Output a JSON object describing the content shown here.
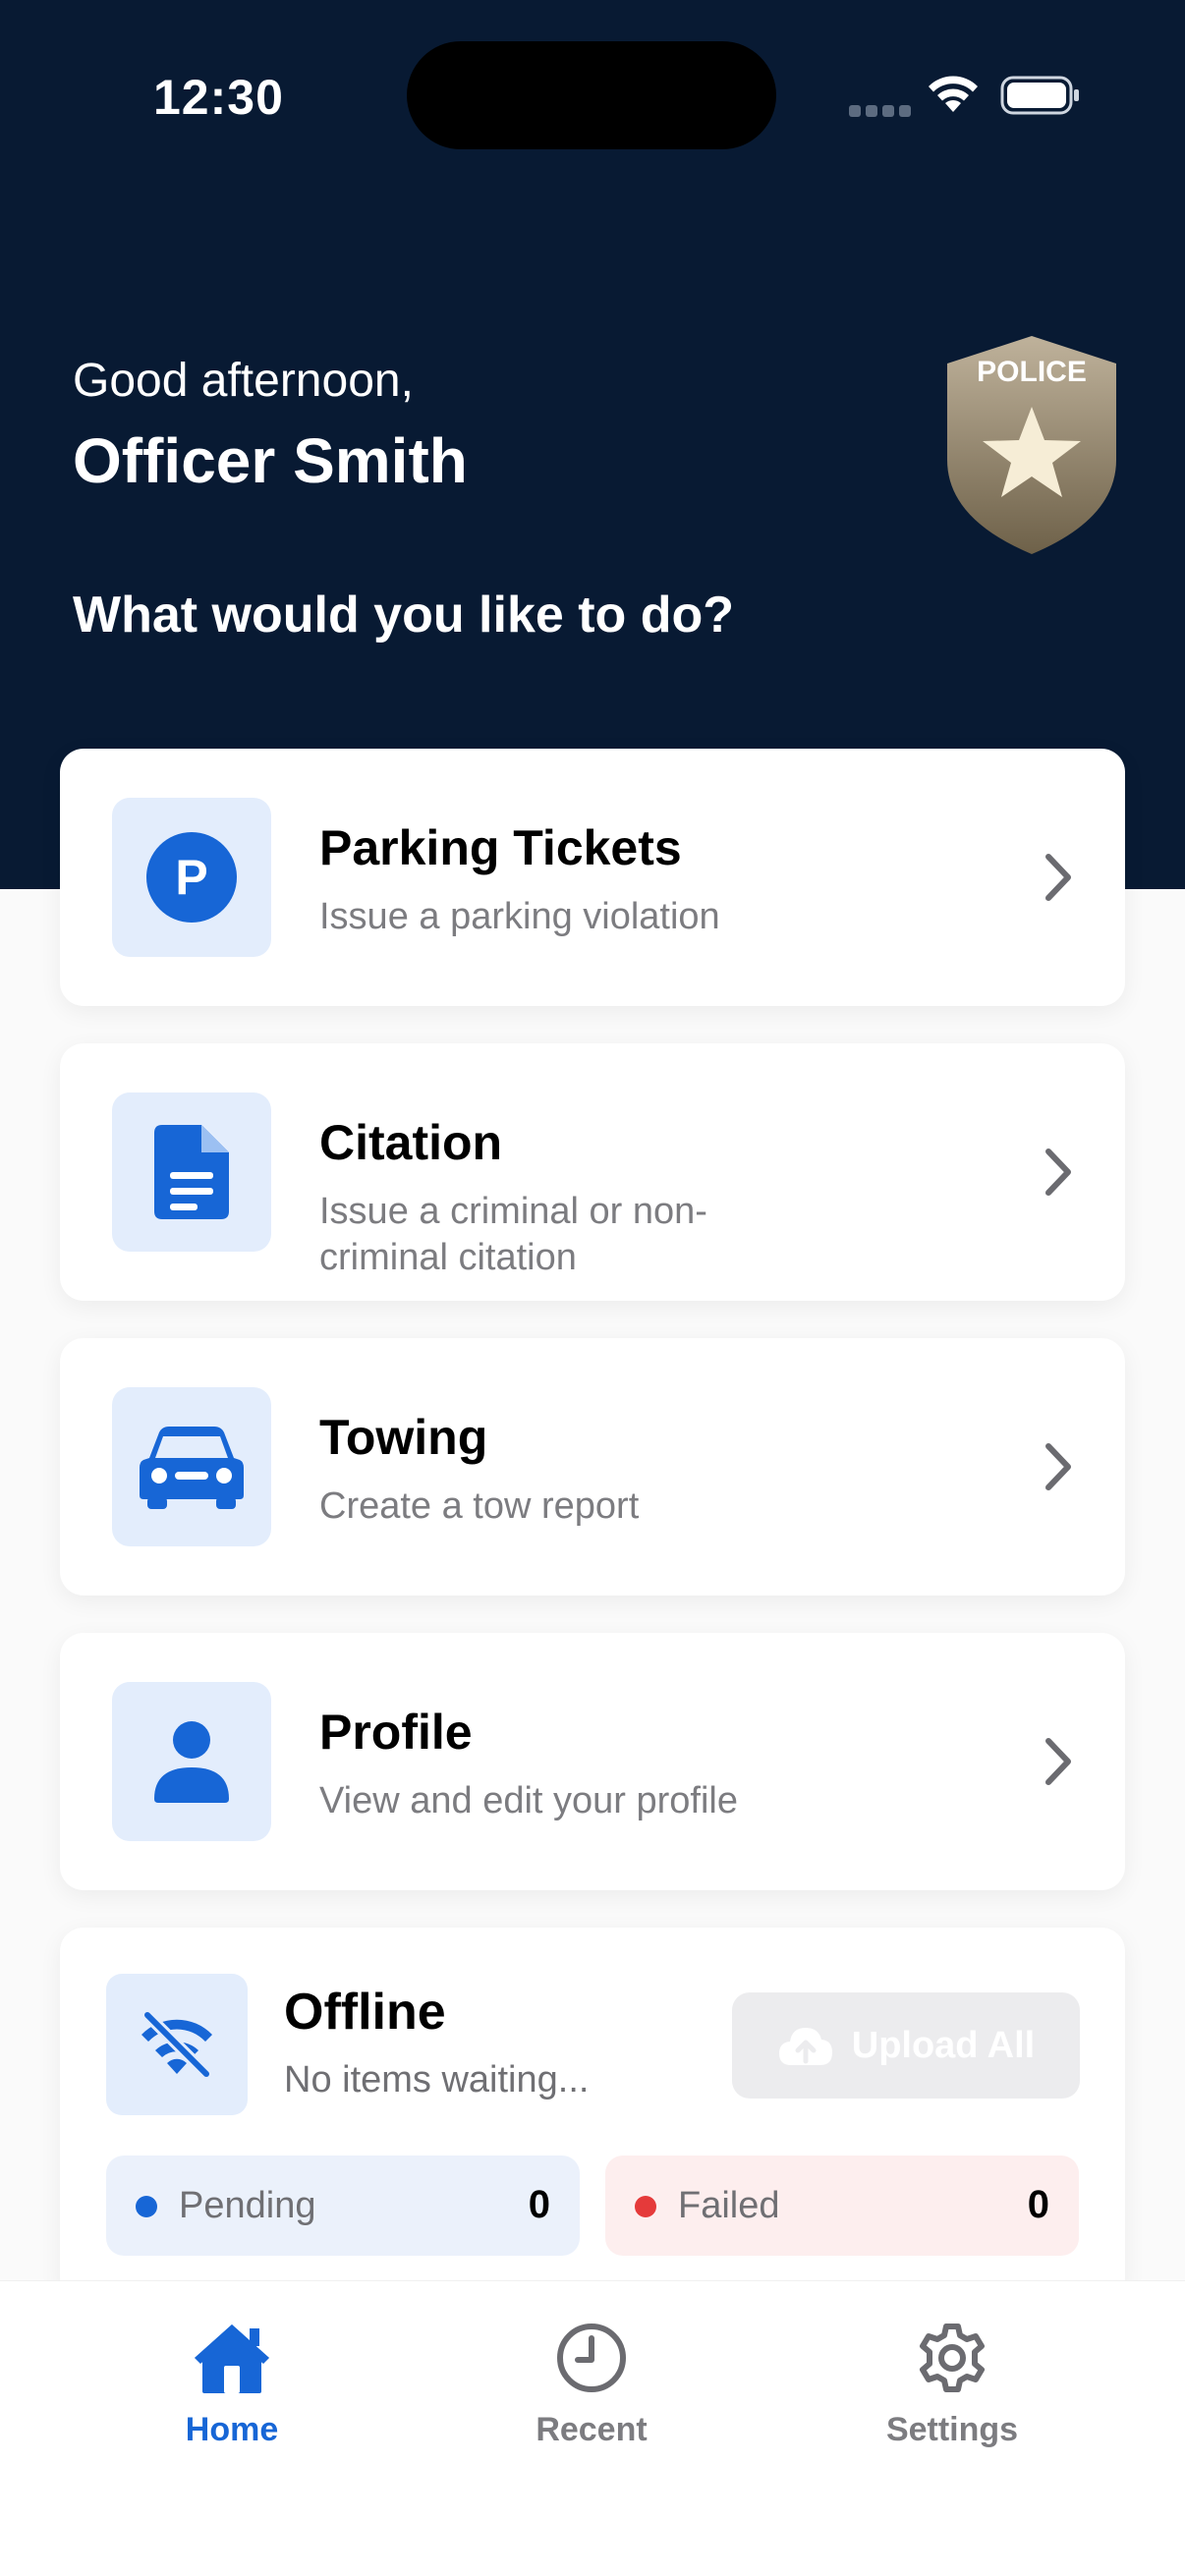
{
  "status_bar": {
    "time": "12:30"
  },
  "header": {
    "greeting": "Good afternoon,",
    "officer_name": "Officer Smith",
    "prompt": "What would you like to do?",
    "badge_text": "POLICE"
  },
  "actions": [
    {
      "title": "Parking Tickets",
      "subtitle": "Issue a parking violation",
      "icon": "parking-icon"
    },
    {
      "title": "Citation",
      "subtitle": "Issue a criminal or non-criminal citation",
      "icon": "document-icon"
    },
    {
      "title": "Towing",
      "subtitle": "Create a tow report",
      "icon": "car-icon"
    },
    {
      "title": "Profile",
      "subtitle": "View and edit your profile",
      "icon": "person-icon"
    }
  ],
  "offline": {
    "title": "Offline",
    "subtitle": "No items waiting...",
    "upload_label": "Upload All",
    "pending_label": "Pending",
    "pending_count": "0",
    "failed_label": "Failed",
    "failed_count": "0"
  },
  "tabs": [
    {
      "label": "Home",
      "icon": "house-icon",
      "active": true
    },
    {
      "label": "Recent",
      "icon": "clock-icon",
      "active": false
    },
    {
      "label": "Settings",
      "icon": "gear-icon",
      "active": false
    }
  ],
  "colors": {
    "header_bg": "#081a33",
    "accent": "#1766d6",
    "icon_tile": "#e3edfc",
    "failed": "#e53a3a"
  }
}
